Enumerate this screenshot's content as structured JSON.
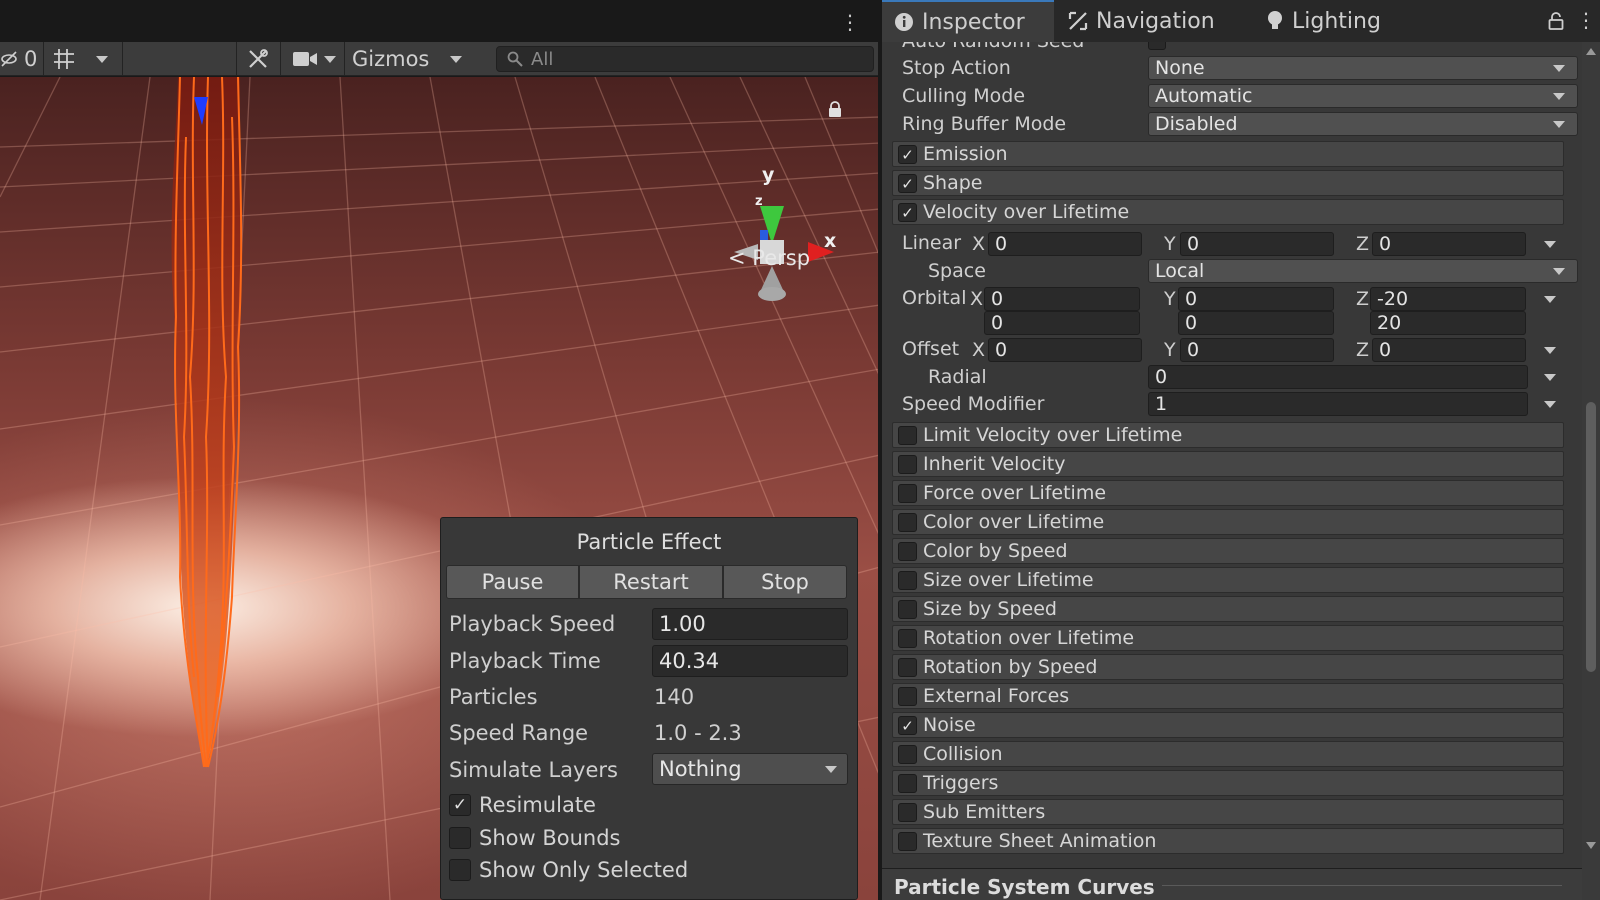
{
  "scene": {
    "toolbar": {
      "hidden_count": "0",
      "gizmos_label": "Gizmos",
      "search_placeholder": "All"
    },
    "gizmo": {
      "y_label": "y",
      "x_label": "x",
      "z_label": "z"
    },
    "projection_label": "Persp"
  },
  "particle_effect": {
    "title": "Particle Effect",
    "buttons": {
      "pause": "Pause",
      "restart": "Restart",
      "stop": "Stop"
    },
    "playback_speed_label": "Playback Speed",
    "playback_speed": "1.00",
    "playback_time_label": "Playback Time",
    "playback_time": "40.34",
    "particles_label": "Particles",
    "particles": "140",
    "speed_range_label": "Speed Range",
    "speed_range": "1.0 - 2.3",
    "simulate_layers_label": "Simulate Layers",
    "simulate_layers": "Nothing",
    "resimulate_label": "Resimulate",
    "resimulate_checked": true,
    "show_bounds_label": "Show Bounds",
    "show_bounds_checked": false,
    "show_only_selected_label": "Show Only Selected",
    "show_only_selected_checked": false
  },
  "inspector": {
    "tabs": [
      {
        "label": "Inspector",
        "icon": "info-icon"
      },
      {
        "label": "Navigation",
        "icon": "navigation-icon"
      },
      {
        "label": "Lighting",
        "icon": "lightbulb-icon"
      }
    ],
    "auto_random_seed_label": "Auto Random Seed",
    "stop_action_label": "Stop Action",
    "stop_action": "None",
    "culling_mode_label": "Culling Mode",
    "culling_mode": "Automatic",
    "ring_buffer_label": "Ring Buffer Mode",
    "ring_buffer": "Disabled",
    "velocity": {
      "linear_label": "Linear",
      "linear": {
        "x": "0",
        "y": "0",
        "z": "0"
      },
      "space_label": "Space",
      "space": "Local",
      "orbital_label": "Orbital",
      "orbital": {
        "x": "0",
        "y": "0",
        "z": "-20",
        "x2": "0",
        "y2": "0",
        "z2": "20"
      },
      "offset_label": "Offset",
      "offset": {
        "x": "0",
        "y": "0",
        "z": "0"
      },
      "radial_label": "Radial",
      "radial": "0",
      "speed_modifier_label": "Speed Modifier",
      "speed_modifier": "1",
      "axis": {
        "x": "X",
        "y": "Y",
        "z": "Z"
      }
    },
    "modules": [
      {
        "label": "Emission",
        "checked": true
      },
      {
        "label": "Shape",
        "checked": true
      },
      {
        "label": "Velocity over Lifetime",
        "checked": true
      },
      {
        "label": "Limit Velocity over Lifetime",
        "checked": false
      },
      {
        "label": "Inherit Velocity",
        "checked": false
      },
      {
        "label": "Force over Lifetime",
        "checked": false
      },
      {
        "label": "Color over Lifetime",
        "checked": false
      },
      {
        "label": "Color by Speed",
        "checked": false
      },
      {
        "label": "Size over Lifetime",
        "checked": false
      },
      {
        "label": "Size by Speed",
        "checked": false
      },
      {
        "label": "Rotation over Lifetime",
        "checked": false
      },
      {
        "label": "Rotation by Speed",
        "checked": false
      },
      {
        "label": "External Forces",
        "checked": false
      },
      {
        "label": "Noise",
        "checked": true
      },
      {
        "label": "Collision",
        "checked": false
      },
      {
        "label": "Triggers",
        "checked": false
      },
      {
        "label": "Sub Emitters",
        "checked": false
      },
      {
        "label": "Texture Sheet Animation",
        "checked": false
      }
    ],
    "curves_header": "Particle System Curves",
    "check_glyph": "✓"
  },
  "colors": {
    "accent": "#3a79bb",
    "flame_outline": "#ff6a1a",
    "axis_x": "#e02020",
    "axis_y": "#3ec83e",
    "axis_z": "#2a5ce0"
  }
}
